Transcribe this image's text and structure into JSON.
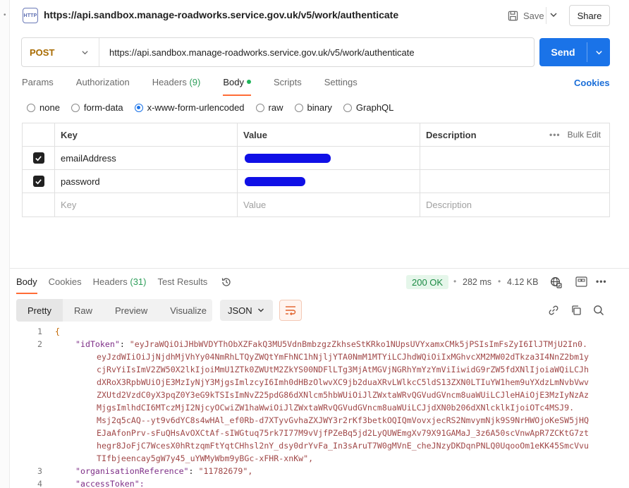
{
  "header": {
    "title": "https://api.sandbox.manage-roadworks.service.gov.uk/v5/work/authenticate",
    "icon_text": "HTTP",
    "save_label": "Save",
    "share_label": "Share"
  },
  "request": {
    "method": "POST",
    "url": "https://api.sandbox.manage-roadworks.service.gov.uk/v5/work/authenticate",
    "send_label": "Send"
  },
  "req_tabs": [
    {
      "label": "Params"
    },
    {
      "label": "Authorization"
    },
    {
      "label": "Headers",
      "count": "(9)"
    },
    {
      "label": "Body"
    },
    {
      "label": "Scripts"
    },
    {
      "label": "Settings"
    }
  ],
  "cookies_label": "Cookies",
  "body_types": [
    "none",
    "form-data",
    "x-www-form-urlencoded",
    "raw",
    "binary",
    "GraphQL"
  ],
  "body_type_selected": "x-www-form-urlencoded",
  "params_table": {
    "headers": {
      "key": "Key",
      "value": "Value",
      "description": "Description",
      "bulk_edit": "Bulk Edit"
    },
    "rows": [
      {
        "key": "emailAddress",
        "checked": true
      },
      {
        "key": "password",
        "checked": true
      }
    ],
    "placeholders": {
      "key": "Key",
      "value": "Value",
      "description": "Description"
    }
  },
  "response": {
    "tabs": [
      {
        "label": "Body"
      },
      {
        "label": "Cookies"
      },
      {
        "label": "Headers",
        "count": "(31)"
      },
      {
        "label": "Test Results"
      }
    ],
    "status": "200 OK",
    "time": "282 ms",
    "size": "4.12 KB",
    "formats": [
      "Pretty",
      "Raw",
      "Preview",
      "Visualize"
    ],
    "language": "JSON"
  },
  "code": {
    "line_numbers": [
      "1",
      "2",
      "3",
      "4"
    ],
    "open_brace": "{",
    "id_token_key": "\"idToken\"",
    "id_token_lines": [
      "\"eyJraWQiOiJHbWVDYThObXZFakQ3MU5VdnBmbzgzZkhseStKRko1NUpsUVYxamxCMk5jPSIsImFsZyI6IlJTMjU2In0.",
      "eyJzdWIiOiJjNjdhMjVhYy04NmRhLTQyZWQtYmFhNC1hNjljYTA0NmM1MTYiLCJhdWQiOiIxMGhvcXM2MW02dTkza3I4NnZ2bm1y",
      "cjRvYiIsImV2ZW50X2lkIjoiMmU1ZTk0ZWUtM2ZkYS00NDFlLTg3MjAtMGVjNGRhYmYzYmViIiwidG9rZW5fdXNlIjoiaWQiLCJh",
      "dXRoX3RpbWUiOjE3MzIyNjY3MjgsImlzcyI6Imh0dHBzOlwvXC9jb2duaXRvLWlkcC5ldS13ZXN0LTIuYW1hem9uYXdzLmNvbVwv",
      "ZXUtd2VzdC0yX3pqZ0Y3eG9kTSIsImNvZ25pdG86dXNlcm5hbWUiOiJlZWxtaWRvQGVudGVncm8uaWUiLCJleHAiOjE3MzIyNzAz",
      "MjgsImlhdCI6MTczMjI2NjcyOCwiZW1haWwiOiJlZWxtaWRvQGVudGVncm8uaWUiLCJjdXN0b206dXNlcklkIjoiOTc4MSJ9.",
      "Msj2q5cAQ--yt9v6dYC8s4wHAl_ef0Rb-d7XTyvGvhaZXJWY3r2rKf3betkOQIQmVovxjecRS2NmvymNjk9S9NrHWOjoKeSW5jHQ",
      "EJaAfonPrv-sFuQHsAvOXCtAf-sIWGtuq75rk7I77M9vVjfPZeBq5jd2LyQUWEmgXv79X91GAMaJ_3z6A50scVnwApR7ZCKtG7zt",
      "hegr8JoFjC7WcesX0hRtzqmFtYqtCHhsl2nY_dsy0drYvFa_In3sAruT7W0gMVnE_cheJNzyDKDqnPNLQ0UqooOm1eKK45SmcVvu",
      "TIfbjeencay5gW7y45_uYWMyWbm9yBGc-xFHR-xnKw\","
    ],
    "org_ref_key": "\"organisationReference\"",
    "org_ref_value": "\"11782679\",",
    "access_token_key": "\"accessToken\":"
  }
}
